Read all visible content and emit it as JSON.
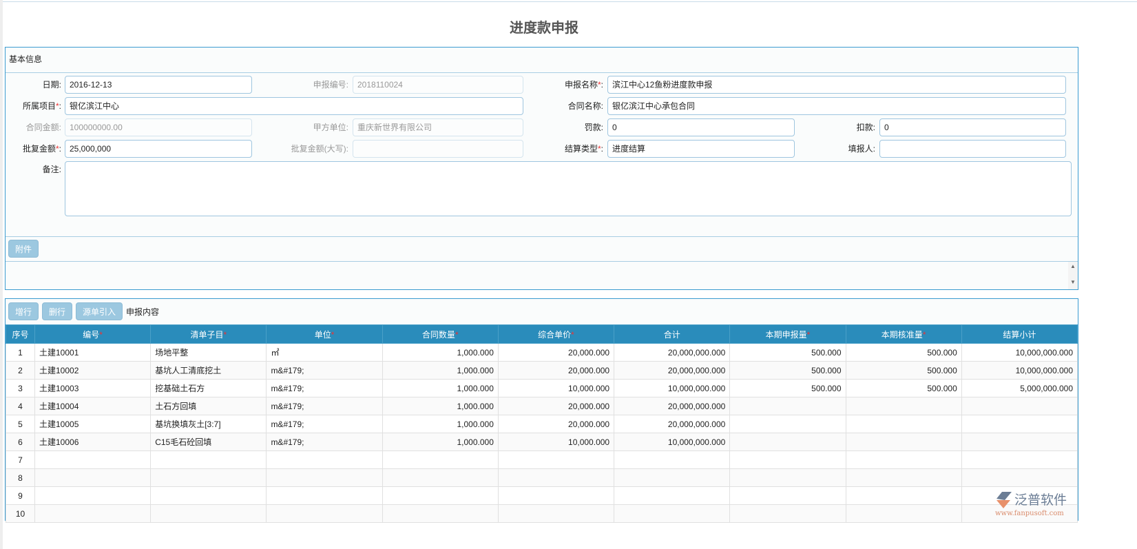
{
  "title": "进度款申报",
  "basic": {
    "header": "基本信息",
    "fields": {
      "date": {
        "label": "日期:",
        "value": "2016-12-13"
      },
      "code": {
        "label": "申报编号:",
        "value": "2018110024"
      },
      "name": {
        "label": "申报名称",
        "value": "滨江中心12鱼粉进度款申报"
      },
      "project": {
        "label": "所属项目",
        "value": "银亿滨江中心"
      },
      "contract": {
        "label": "合同名称:",
        "value": "银亿滨江中心承包合同"
      },
      "amount": {
        "label": "合同金额:",
        "value": "100000000.00"
      },
      "partyA": {
        "label": "甲方单位:",
        "value": "重庆新世界有限公司"
      },
      "penalty": {
        "label": "罚款:",
        "value": "0"
      },
      "deduct": {
        "label": "扣款:",
        "value": "0"
      },
      "approved": {
        "label": "批复金额",
        "value": "25,000,000"
      },
      "approvedCap": {
        "label": "批复金额(大写):",
        "value": ""
      },
      "settleType": {
        "label": "结算类型",
        "value": "进度结算"
      },
      "filler": {
        "label": "填报人:",
        "value": ""
      },
      "remark": {
        "label": "备注:",
        "value": ""
      }
    },
    "req": "*",
    "colon": ":"
  },
  "attach": {
    "button": "附件"
  },
  "grid": {
    "buttons": {
      "add": "增行",
      "del": "删行",
      "import": "源单引入"
    },
    "caption": "申报内容",
    "headers": [
      "序号",
      "编号",
      "清单子目",
      "单位",
      "合同数量",
      "综合单价",
      "合计",
      "本期申报量",
      "本期核准量",
      "结算小计"
    ],
    "required": [
      false,
      true,
      true,
      true,
      true,
      true,
      false,
      true,
      true,
      false
    ],
    "rows": [
      [
        "1",
        "土建10001",
        "场地平整",
        "㎡",
        "1,000.000",
        "20,000.000",
        "20,000,000.000",
        "500.000",
        "500.000",
        "10,000,000.000"
      ],
      [
        "2",
        "土建10002",
        "基坑人工清底挖土",
        "m&#179;",
        "1,000.000",
        "20,000.000",
        "20,000,000.000",
        "500.000",
        "500.000",
        "10,000,000.000"
      ],
      [
        "3",
        "土建10003",
        "挖基础土石方",
        "m&#179;",
        "1,000.000",
        "10,000.000",
        "10,000,000.000",
        "500.000",
        "500.000",
        "5,000,000.000"
      ],
      [
        "4",
        "土建10004",
        "土石方回填",
        "m&#179;",
        "1,000.000",
        "20,000.000",
        "20,000,000.000",
        "",
        "",
        ""
      ],
      [
        "5",
        "土建10005",
        "基坑换填灰土[3:7]",
        "m&#179;",
        "1,000.000",
        "20,000.000",
        "20,000,000.000",
        "",
        "",
        ""
      ],
      [
        "6",
        "土建10006",
        "C15毛石砼回填",
        "m&#179;",
        "1,000.000",
        "10,000.000",
        "10,000,000.000",
        "",
        "",
        ""
      ],
      [
        "7",
        "",
        "",
        "",
        "",
        "",
        "",
        "",
        "",
        ""
      ],
      [
        "8",
        "",
        "",
        "",
        "",
        "",
        "",
        "",
        "",
        ""
      ],
      [
        "9",
        "",
        "",
        "",
        "",
        "",
        "",
        "",
        "",
        ""
      ],
      [
        "10",
        "",
        "",
        "",
        "",
        "",
        "",
        "",
        "",
        ""
      ]
    ]
  },
  "logo": {
    "name": "泛普软件",
    "url": "www.fanpusoft.com"
  }
}
